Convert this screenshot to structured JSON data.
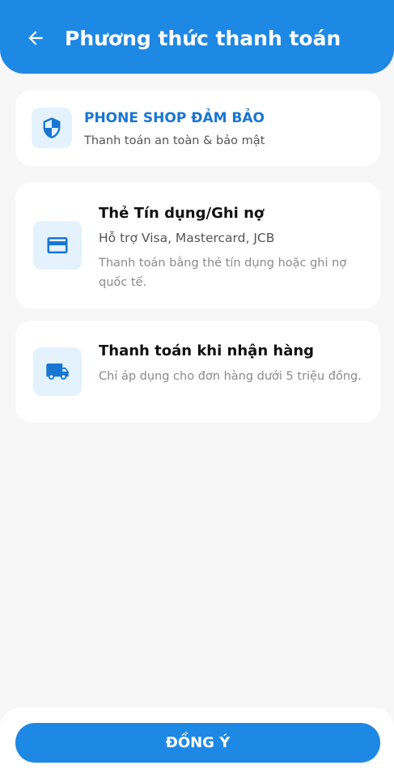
{
  "header": {
    "title": "Phương thức thanh toán",
    "back_icon": "arrow-left-icon",
    "background": "#1e88e5"
  },
  "guarantee": {
    "icon": "shield-icon",
    "title": "PHONE SHOP ĐẢM BẢO",
    "subtitle": "Thanh toán an toàn & bảo mật"
  },
  "payment_methods": [
    {
      "icon": "credit-card-icon",
      "title": "Thẻ Tín dụng/Ghi nợ",
      "support": "Hỗ trợ Visa, Mastercard, JCB",
      "description": "Thanh toán bằng thẻ tín dụng hoặc ghi nợ quốc tế."
    },
    {
      "icon": "truck-icon",
      "title": "Thanh toán khi nhận hàng",
      "description": "Chỉ áp dụng cho đơn hàng dưới 5 triệu đồng."
    }
  ],
  "footer": {
    "confirm_label": "ĐỒNG Ý"
  },
  "colors": {
    "accent": "#1e88e5",
    "icon_bg": "#e3f2fd",
    "page_bg": "#f7f7f7"
  }
}
